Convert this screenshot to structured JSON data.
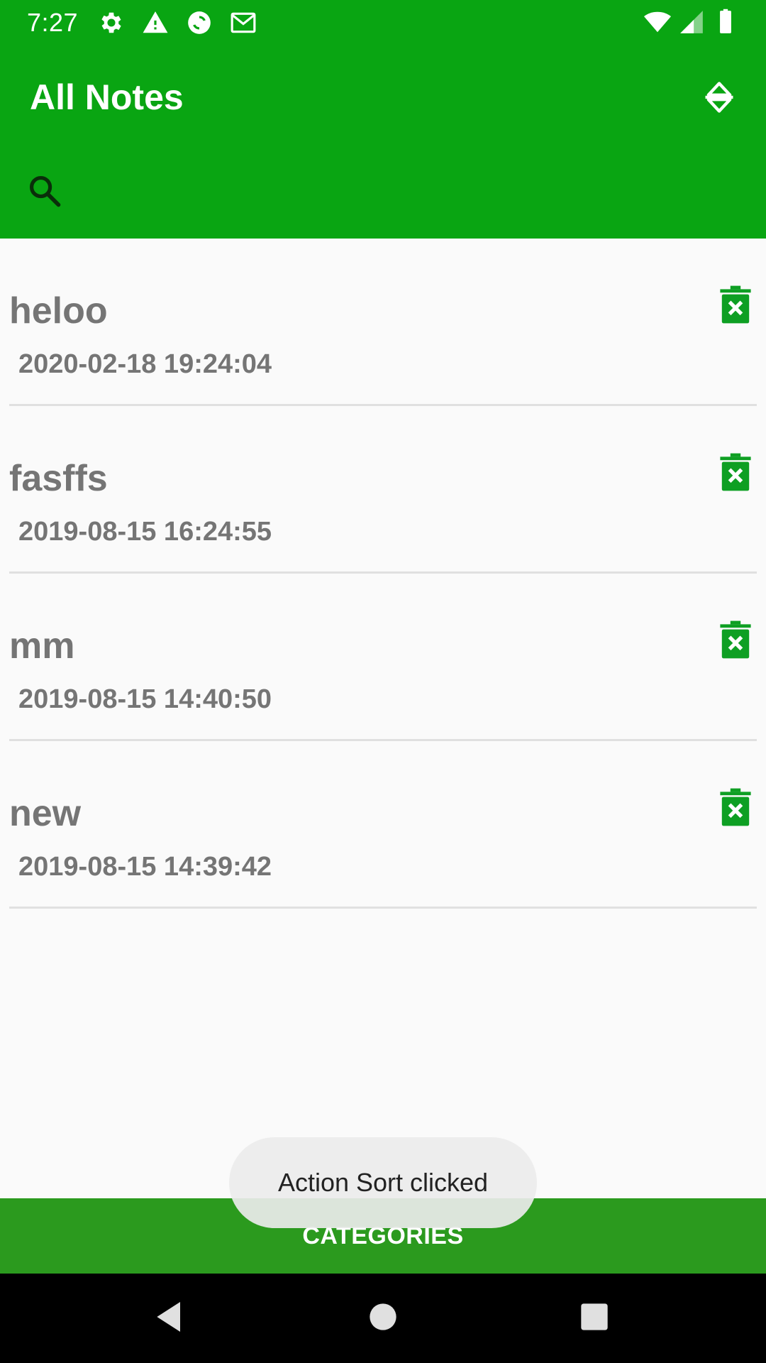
{
  "status_bar": {
    "time": "7:27",
    "left_icons": [
      "gear-icon",
      "warning-icon",
      "sync-icon",
      "mail-icon"
    ],
    "right_icons": [
      "wifi-icon",
      "signal-icon",
      "battery-icon"
    ]
  },
  "app_bar": {
    "title": "All Notes",
    "sort_icon": "sort-icon",
    "search_icon": "search-icon",
    "color": "#09a512"
  },
  "notes": [
    {
      "title": "heloo",
      "date": "2020-02-18 19:24:04"
    },
    {
      "title": "fasffs",
      "date": "2019-08-15 16:24:55"
    },
    {
      "title": "mm",
      "date": "2019-08-15 14:40:50"
    },
    {
      "title": "new",
      "date": "2019-08-15 14:39:42"
    }
  ],
  "delete_icon": "delete-icon",
  "categories": {
    "label": "CATEGORIES",
    "color": "#2b9a1e"
  },
  "toast": {
    "text": "Action Sort clicked"
  },
  "nav_bar": {
    "icons": [
      "back-icon",
      "home-icon",
      "recents-icon"
    ]
  }
}
